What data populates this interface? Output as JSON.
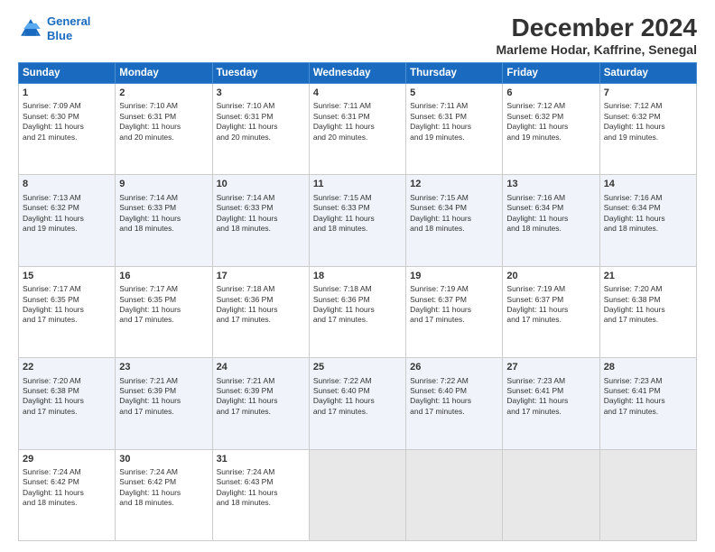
{
  "header": {
    "logo_line1": "General",
    "logo_line2": "Blue",
    "title": "December 2024",
    "subtitle": "Marleme Hodar, Kaffrine, Senegal"
  },
  "columns": [
    "Sunday",
    "Monday",
    "Tuesday",
    "Wednesday",
    "Thursday",
    "Friday",
    "Saturday"
  ],
  "weeks": [
    [
      {
        "day": "1",
        "lines": [
          "Sunrise: 7:09 AM",
          "Sunset: 6:30 PM",
          "Daylight: 11 hours",
          "and 21 minutes."
        ]
      },
      {
        "day": "2",
        "lines": [
          "Sunrise: 7:10 AM",
          "Sunset: 6:31 PM",
          "Daylight: 11 hours",
          "and 20 minutes."
        ]
      },
      {
        "day": "3",
        "lines": [
          "Sunrise: 7:10 AM",
          "Sunset: 6:31 PM",
          "Daylight: 11 hours",
          "and 20 minutes."
        ]
      },
      {
        "day": "4",
        "lines": [
          "Sunrise: 7:11 AM",
          "Sunset: 6:31 PM",
          "Daylight: 11 hours",
          "and 20 minutes."
        ]
      },
      {
        "day": "5",
        "lines": [
          "Sunrise: 7:11 AM",
          "Sunset: 6:31 PM",
          "Daylight: 11 hours",
          "and 19 minutes."
        ]
      },
      {
        "day": "6",
        "lines": [
          "Sunrise: 7:12 AM",
          "Sunset: 6:32 PM",
          "Daylight: 11 hours",
          "and 19 minutes."
        ]
      },
      {
        "day": "7",
        "lines": [
          "Sunrise: 7:12 AM",
          "Sunset: 6:32 PM",
          "Daylight: 11 hours",
          "and 19 minutes."
        ]
      }
    ],
    [
      {
        "day": "8",
        "lines": [
          "Sunrise: 7:13 AM",
          "Sunset: 6:32 PM",
          "Daylight: 11 hours",
          "and 19 minutes."
        ]
      },
      {
        "day": "9",
        "lines": [
          "Sunrise: 7:14 AM",
          "Sunset: 6:33 PM",
          "Daylight: 11 hours",
          "and 18 minutes."
        ]
      },
      {
        "day": "10",
        "lines": [
          "Sunrise: 7:14 AM",
          "Sunset: 6:33 PM",
          "Daylight: 11 hours",
          "and 18 minutes."
        ]
      },
      {
        "day": "11",
        "lines": [
          "Sunrise: 7:15 AM",
          "Sunset: 6:33 PM",
          "Daylight: 11 hours",
          "and 18 minutes."
        ]
      },
      {
        "day": "12",
        "lines": [
          "Sunrise: 7:15 AM",
          "Sunset: 6:34 PM",
          "Daylight: 11 hours",
          "and 18 minutes."
        ]
      },
      {
        "day": "13",
        "lines": [
          "Sunrise: 7:16 AM",
          "Sunset: 6:34 PM",
          "Daylight: 11 hours",
          "and 18 minutes."
        ]
      },
      {
        "day": "14",
        "lines": [
          "Sunrise: 7:16 AM",
          "Sunset: 6:34 PM",
          "Daylight: 11 hours",
          "and 18 minutes."
        ]
      }
    ],
    [
      {
        "day": "15",
        "lines": [
          "Sunrise: 7:17 AM",
          "Sunset: 6:35 PM",
          "Daylight: 11 hours",
          "and 17 minutes."
        ]
      },
      {
        "day": "16",
        "lines": [
          "Sunrise: 7:17 AM",
          "Sunset: 6:35 PM",
          "Daylight: 11 hours",
          "and 17 minutes."
        ]
      },
      {
        "day": "17",
        "lines": [
          "Sunrise: 7:18 AM",
          "Sunset: 6:36 PM",
          "Daylight: 11 hours",
          "and 17 minutes."
        ]
      },
      {
        "day": "18",
        "lines": [
          "Sunrise: 7:18 AM",
          "Sunset: 6:36 PM",
          "Daylight: 11 hours",
          "and 17 minutes."
        ]
      },
      {
        "day": "19",
        "lines": [
          "Sunrise: 7:19 AM",
          "Sunset: 6:37 PM",
          "Daylight: 11 hours",
          "and 17 minutes."
        ]
      },
      {
        "day": "20",
        "lines": [
          "Sunrise: 7:19 AM",
          "Sunset: 6:37 PM",
          "Daylight: 11 hours",
          "and 17 minutes."
        ]
      },
      {
        "day": "21",
        "lines": [
          "Sunrise: 7:20 AM",
          "Sunset: 6:38 PM",
          "Daylight: 11 hours",
          "and 17 minutes."
        ]
      }
    ],
    [
      {
        "day": "22",
        "lines": [
          "Sunrise: 7:20 AM",
          "Sunset: 6:38 PM",
          "Daylight: 11 hours",
          "and 17 minutes."
        ]
      },
      {
        "day": "23",
        "lines": [
          "Sunrise: 7:21 AM",
          "Sunset: 6:39 PM",
          "Daylight: 11 hours",
          "and 17 minutes."
        ]
      },
      {
        "day": "24",
        "lines": [
          "Sunrise: 7:21 AM",
          "Sunset: 6:39 PM",
          "Daylight: 11 hours",
          "and 17 minutes."
        ]
      },
      {
        "day": "25",
        "lines": [
          "Sunrise: 7:22 AM",
          "Sunset: 6:40 PM",
          "Daylight: 11 hours",
          "and 17 minutes."
        ]
      },
      {
        "day": "26",
        "lines": [
          "Sunrise: 7:22 AM",
          "Sunset: 6:40 PM",
          "Daylight: 11 hours",
          "and 17 minutes."
        ]
      },
      {
        "day": "27",
        "lines": [
          "Sunrise: 7:23 AM",
          "Sunset: 6:41 PM",
          "Daylight: 11 hours",
          "and 17 minutes."
        ]
      },
      {
        "day": "28",
        "lines": [
          "Sunrise: 7:23 AM",
          "Sunset: 6:41 PM",
          "Daylight: 11 hours",
          "and 17 minutes."
        ]
      }
    ],
    [
      {
        "day": "29",
        "lines": [
          "Sunrise: 7:24 AM",
          "Sunset: 6:42 PM",
          "Daylight: 11 hours",
          "and 18 minutes."
        ]
      },
      {
        "day": "30",
        "lines": [
          "Sunrise: 7:24 AM",
          "Sunset: 6:42 PM",
          "Daylight: 11 hours",
          "and 18 minutes."
        ]
      },
      {
        "day": "31",
        "lines": [
          "Sunrise: 7:24 AM",
          "Sunset: 6:43 PM",
          "Daylight: 11 hours",
          "and 18 minutes."
        ]
      },
      null,
      null,
      null,
      null
    ]
  ]
}
